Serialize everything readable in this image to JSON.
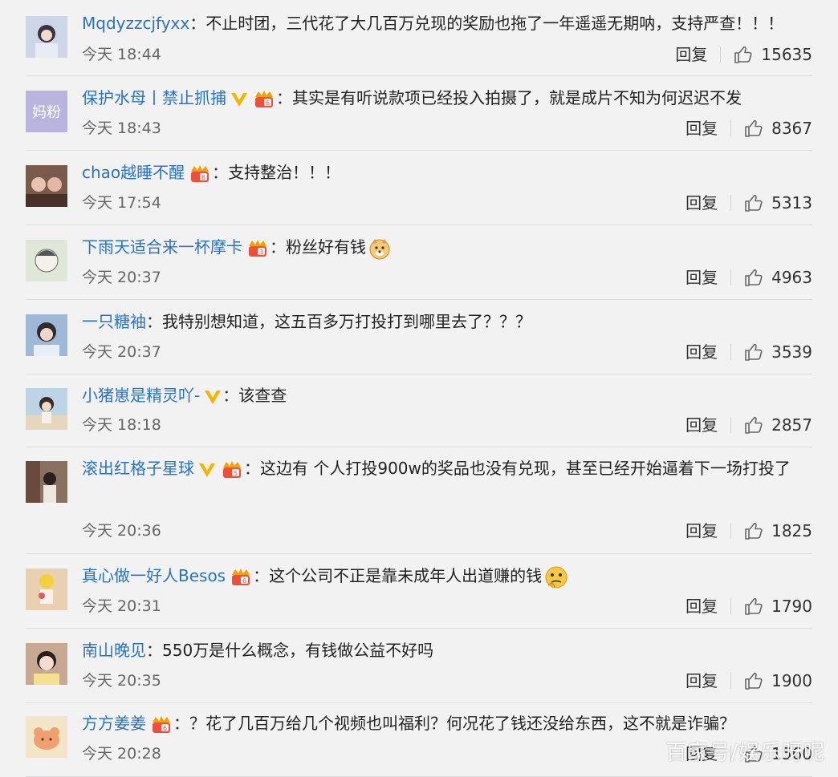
{
  "comments": [
    {
      "user": "Mqdyzzcjfyxx",
      "text": "不止时团，三代花了大几百万兑现的奖励也拖了一年遥遥无期呐，支持严查！！！",
      "time": "今天 18:44",
      "reply": "回复",
      "likes": "15635",
      "avatar_color": "#cdd6e8"
    },
    {
      "user": "保护水母丨禁止抓捕",
      "text": "其实是有听说款项已经投入拍摄了，就是成片不知为何迟迟不发",
      "time": "今天 18:43",
      "reply": "回复",
      "likes": "8367",
      "avatar_label": "妈粉",
      "avatar_color": "#b9b4de"
    },
    {
      "user": "chao越睡不醒",
      "text": "支持整治！！！",
      "time": "今天 17:54",
      "reply": "回复",
      "likes": "5313",
      "avatar_color": "#7a5a4a"
    },
    {
      "user": "下雨天适合来一杯摩卡",
      "text": "粉丝好有钱",
      "time": "今天 20:37",
      "reply": "回复",
      "likes": "4963",
      "avatar_color": "#dfe7d8"
    },
    {
      "user": "一只糖袖",
      "text": "我特别想知道，这五百多万打投打到哪里去了？？？",
      "time": "今天 20:37",
      "reply": "回复",
      "likes": "3539",
      "avatar_color": "#9fb8d8"
    },
    {
      "user": "小猪崽是精灵吖-",
      "text": "该查查",
      "time": "今天 18:18",
      "reply": "回复",
      "likes": "2857",
      "avatar_color": "#bcd4e6"
    },
    {
      "user": "滚出红格子星球",
      "text": "这边有 个人打投900w的奖品也没有兑现，甚至已经开始逼着下一场打投了",
      "time": "今天 20:36",
      "reply": "回复",
      "likes": "1825",
      "avatar_color": "#8a7060"
    },
    {
      "user": "真心做一好人Besos",
      "text": "这个公司不正是靠未成年人出道赚的钱",
      "time": "今天 20:31",
      "reply": "回复",
      "likes": "1790",
      "avatar_color": "#e8d0b0"
    },
    {
      "user": "南山晚见",
      "text": "550万是什么概念，有钱做公益不好吗",
      "time": "今天 20:35",
      "reply": "回复",
      "likes": "1900",
      "avatar_color": "#c8a890"
    },
    {
      "user": "方方姜姜",
      "text": "？花了几百万给几个视频也叫福利？何况花了钱还没给东西，这不就是诈骗？",
      "time": "今天 20:28",
      "reply": "回复",
      "likes": "1560",
      "avatar_color": "#f3e6c8"
    }
  ],
  "watermark": "百家号/娱乐呀呢"
}
